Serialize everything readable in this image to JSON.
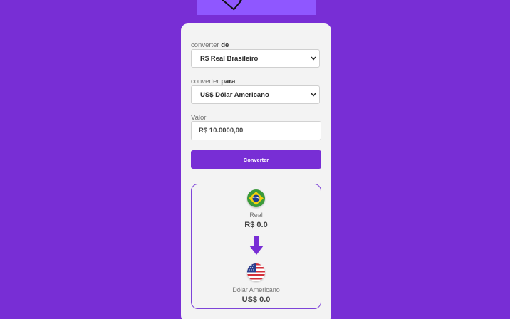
{
  "form": {
    "from_label_prefix": "converter ",
    "from_label_bold": "de",
    "from_value": "R$ Real Brasileiro",
    "to_label_prefix": "converter ",
    "to_label_bold": "para",
    "to_value": "US$ Dólar Americano",
    "amount_label": "Valor",
    "amount_value": "R$ 10.0000,00",
    "convert_button": "Converter"
  },
  "result": {
    "from_name": "Real",
    "from_value": "R$ 0.0",
    "to_name": "Dólar Americano",
    "to_value": "US$ 0.0"
  },
  "icons": {
    "from_flag": "brazil-flag-icon",
    "arrow": "arrow-down-icon",
    "to_flag": "usa-flag-icon"
  },
  "colors": {
    "background": "#782ed5",
    "accent": "#782ed5",
    "card": "#f3f3f3"
  }
}
